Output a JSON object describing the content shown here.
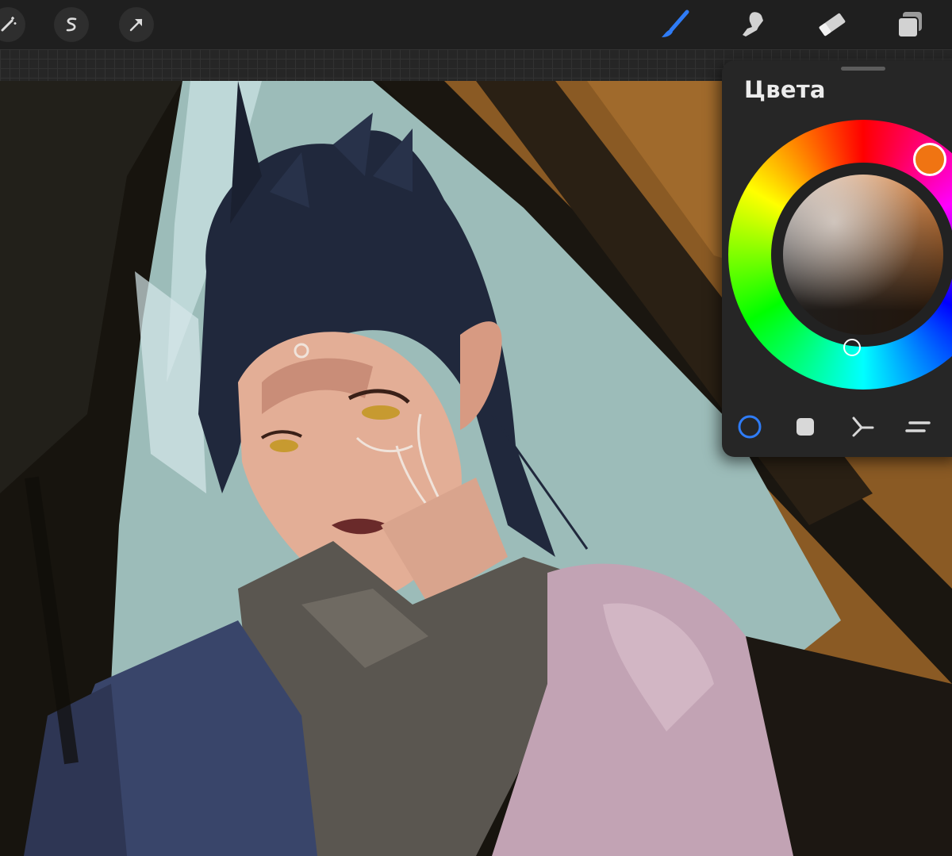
{
  "toolbar": {
    "left_icons": [
      "adjustments-magic-icon",
      "selection-s-icon",
      "transform-arrow-icon"
    ],
    "right_icons": [
      "brush-icon",
      "smudge-icon",
      "eraser-icon",
      "layers-icon"
    ],
    "active_tool": "brush",
    "active_color": "#2f7cf6"
  },
  "colors_panel": {
    "title": "Цвета",
    "current_hue_color": "#f07412",
    "modes": [
      "disc-mode-icon",
      "classic-mode-icon",
      "harmony-mode-icon",
      "value-mode-icon"
    ],
    "active_mode": "disc",
    "active_mode_color": "#2f7cf6"
  },
  "canvas": {
    "description_colors": {
      "background_wall": "#8a5a24",
      "sky_light": "#9bbbb8",
      "hair": "#20283c",
      "skin": "#e6b09a",
      "collar": "#5a5650",
      "shoulder": "#c2a3b4",
      "jacket": "#39456a"
    }
  }
}
